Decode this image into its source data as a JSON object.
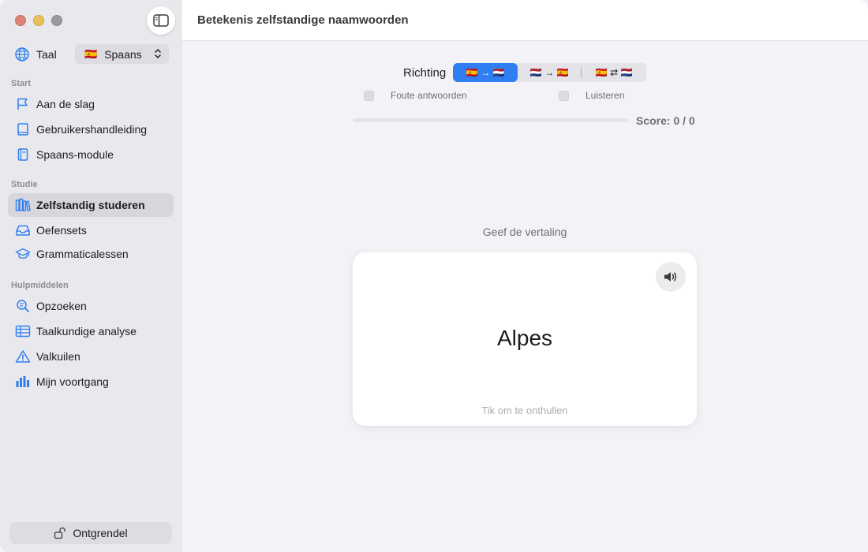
{
  "header": {
    "title": "Betekenis zelfstandige naamwoorden"
  },
  "sidebar": {
    "language": {
      "label": "Taal",
      "flag": "🇪🇸",
      "selected": "Spaans"
    },
    "sections": [
      {
        "title": "Start",
        "items": [
          {
            "label": "Aan de slag",
            "icon": "flag-icon"
          },
          {
            "label": "Gebruikershandleiding",
            "icon": "book-icon"
          },
          {
            "label": "Spaans-module",
            "icon": "notebook-icon"
          }
        ]
      },
      {
        "title": "Studie",
        "items": [
          {
            "label": "Zelfstandig studeren",
            "icon": "books-icon",
            "active": true
          },
          {
            "label": "Oefensets",
            "icon": "tray-icon"
          },
          {
            "label": "Grammaticalessen",
            "icon": "graduation-cap-icon"
          }
        ]
      },
      {
        "title": "Hulpmiddelen",
        "items": [
          {
            "label": "Opzoeken",
            "icon": "magnifier-icon"
          },
          {
            "label": "Taalkundige analyse",
            "icon": "table-icon"
          },
          {
            "label": "Valkuilen",
            "icon": "warning-icon"
          },
          {
            "label": "Mijn voortgang",
            "icon": "bar-chart-icon"
          }
        ]
      }
    ],
    "unlock_label": "Ontgrendel"
  },
  "study": {
    "direction_label": "Richting",
    "directions": [
      {
        "label": "🇪🇸 → 🇳🇱",
        "selected": true
      },
      {
        "label": "🇳🇱 → 🇪🇸",
        "selected": false
      },
      {
        "label": "🇪🇸 ⇄ 🇳🇱",
        "selected": false
      }
    ],
    "options": [
      {
        "label": "Foute antwoorden",
        "checked": false
      },
      {
        "label": "Luisteren",
        "checked": false
      }
    ],
    "progress": 0,
    "score": "Score: 0 / 0",
    "prompt": "Geef de vertaling",
    "card": {
      "word": "Alpes",
      "hint": "Tik om te onthullen"
    }
  },
  "colors": {
    "accent": "#2f7ff0",
    "sidebar_bg": "#e8e8ed",
    "content_bg": "#f3f3f7"
  }
}
